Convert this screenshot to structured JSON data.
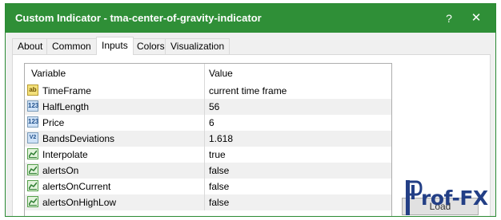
{
  "window": {
    "title": "Custom Indicator - tma-center-of-gravity-indicator",
    "help_glyph": "?",
    "close_glyph": "✕",
    "accent": "#2f8f37"
  },
  "tabs": [
    "About",
    "Common",
    "Inputs",
    "Colors",
    "Visualization"
  ],
  "active_tab": "Inputs",
  "table": {
    "headers": {
      "variable": "Variable",
      "value": "Value"
    },
    "rows": [
      {
        "icon": "ab-icon",
        "icon_text": "ab",
        "variable": "TimeFrame",
        "value": "current time frame"
      },
      {
        "icon": "number-123-icon",
        "icon_text": "123",
        "variable": "HalfLength",
        "value": "56"
      },
      {
        "icon": "number-123-icon",
        "icon_text": "123",
        "variable": "Price",
        "value": "6"
      },
      {
        "icon": "fraction-icon",
        "icon_text": "V2",
        "variable": "BandsDeviations",
        "value": "1.618"
      },
      {
        "icon": "boolean-chart-icon",
        "icon_text": "",
        "variable": "Interpolate",
        "value": "true"
      },
      {
        "icon": "boolean-chart-icon",
        "icon_text": "",
        "variable": "alertsOn",
        "value": "false"
      },
      {
        "icon": "boolean-chart-icon",
        "icon_text": "",
        "variable": "alertsOnCurrent",
        "value": "false"
      },
      {
        "icon": "boolean-chart-icon",
        "icon_text": "",
        "variable": "alertsOnHighLow",
        "value": "false"
      }
    ]
  },
  "side_button": {
    "label": "Load"
  },
  "watermark": {
    "text": "rof-FX",
    "color": "#233f86"
  }
}
